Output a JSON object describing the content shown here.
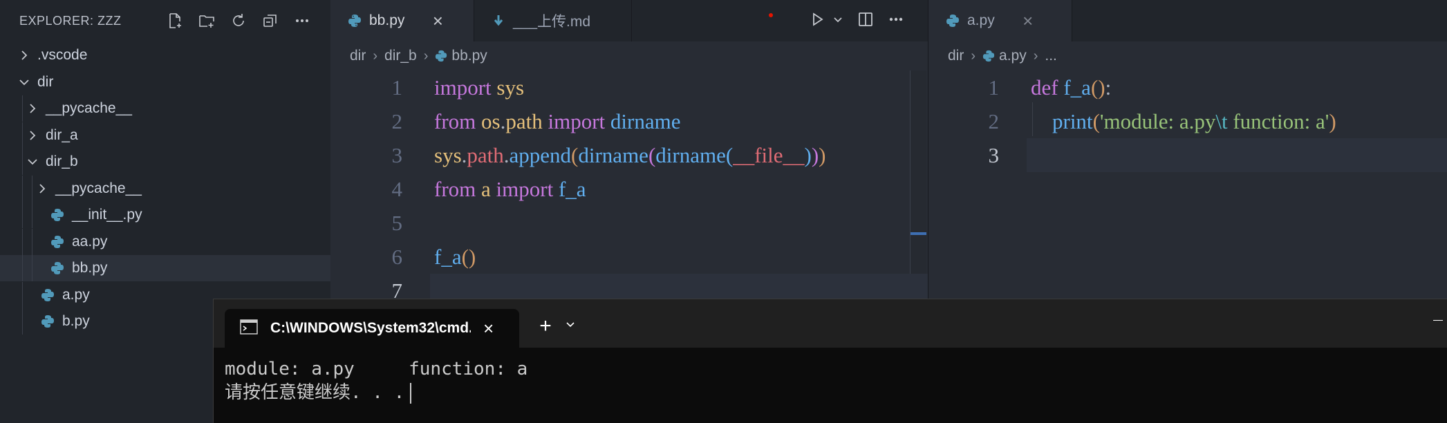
{
  "explorer": {
    "title": "EXPLORER: ZZZ",
    "actions": [
      "new-file",
      "new-folder",
      "refresh",
      "collapse-all",
      "more"
    ],
    "tree": [
      {
        "label": ".vscode",
        "type": "folder",
        "expanded": false,
        "depth": 0
      },
      {
        "label": "dir",
        "type": "folder",
        "expanded": true,
        "depth": 0
      },
      {
        "label": "__pycache__",
        "type": "folder",
        "expanded": false,
        "depth": 1
      },
      {
        "label": "dir_a",
        "type": "folder",
        "expanded": false,
        "depth": 1
      },
      {
        "label": "dir_b",
        "type": "folder",
        "expanded": true,
        "depth": 1
      },
      {
        "label": "__pycache__",
        "type": "folder",
        "expanded": false,
        "depth": 2
      },
      {
        "label": "__init__.py",
        "type": "python",
        "depth": 2
      },
      {
        "label": "aa.py",
        "type": "python",
        "depth": 2
      },
      {
        "label": "bb.py",
        "type": "python",
        "depth": 2,
        "selected": true
      },
      {
        "label": "a.py",
        "type": "python",
        "depth": 1
      },
      {
        "label": "b.py",
        "type": "python",
        "depth": 1
      }
    ]
  },
  "group1": {
    "tabs": [
      {
        "label": "bb.py",
        "active": true
      },
      {
        "label": "___上传.md",
        "active": false
      }
    ],
    "breadcrumb": [
      "dir",
      "dir_b",
      "bb.py"
    ],
    "current_line": 7,
    "lines": [
      {
        "n": "1",
        "text": "import sys"
      },
      {
        "n": "2",
        "text": "from os.path import dirname"
      },
      {
        "n": "3",
        "text": "sys.path.append(dirname(dirname(__file__)))"
      },
      {
        "n": "4",
        "text": "from a import f_a"
      },
      {
        "n": "5",
        "text": ""
      },
      {
        "n": "6",
        "text": "f_a()"
      },
      {
        "n": "7",
        "text": ""
      }
    ]
  },
  "group2": {
    "tabs": [
      {
        "label": "a.py",
        "active": true
      }
    ],
    "breadcrumb": [
      "dir",
      "a.py",
      "..."
    ],
    "current_line": 3,
    "lines": [
      {
        "n": "1",
        "text": "def f_a():"
      },
      {
        "n": "2",
        "text": "    print('module: a.py\\t function: a')"
      },
      {
        "n": "3",
        "text": ""
      }
    ]
  },
  "terminal": {
    "tab_title": "C:\\WINDOWS\\System32\\cmd.",
    "output": [
      "module: a.py     function: a",
      "请按任意键继续. . ."
    ]
  },
  "colors": {
    "accent_python_icon": "#519aba",
    "keyword": "#c678dd",
    "function": "#61afef",
    "module": "#e5c07b",
    "string": "#98c379",
    "unsaved_dot": "#e51400"
  }
}
